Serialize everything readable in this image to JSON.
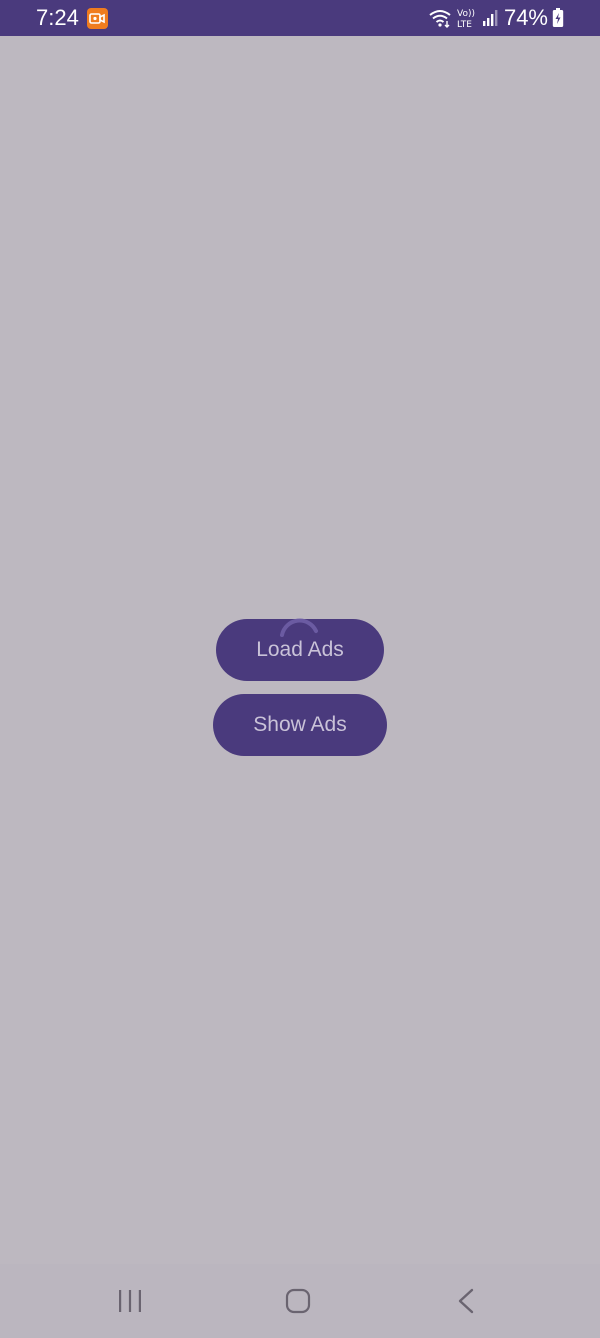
{
  "status_bar": {
    "time": "7:24",
    "battery": "74%",
    "network_label_top": "Vo))",
    "network_label_bottom": "LTE",
    "icons": [
      "screen-recorder-icon",
      "wifi-icon",
      "volte-icon",
      "signal-icon",
      "battery-icon"
    ]
  },
  "main": {
    "loading": true,
    "buttons": {
      "load_label": "Load Ads",
      "show_label": "Show Ads"
    }
  },
  "nav_bar": {
    "icons": [
      "recents-icon",
      "home-icon",
      "back-icon"
    ]
  },
  "colors": {
    "accent": "#4a3a7d",
    "scrim": "#bdb8c0",
    "button_text": "#c9c2d8"
  }
}
